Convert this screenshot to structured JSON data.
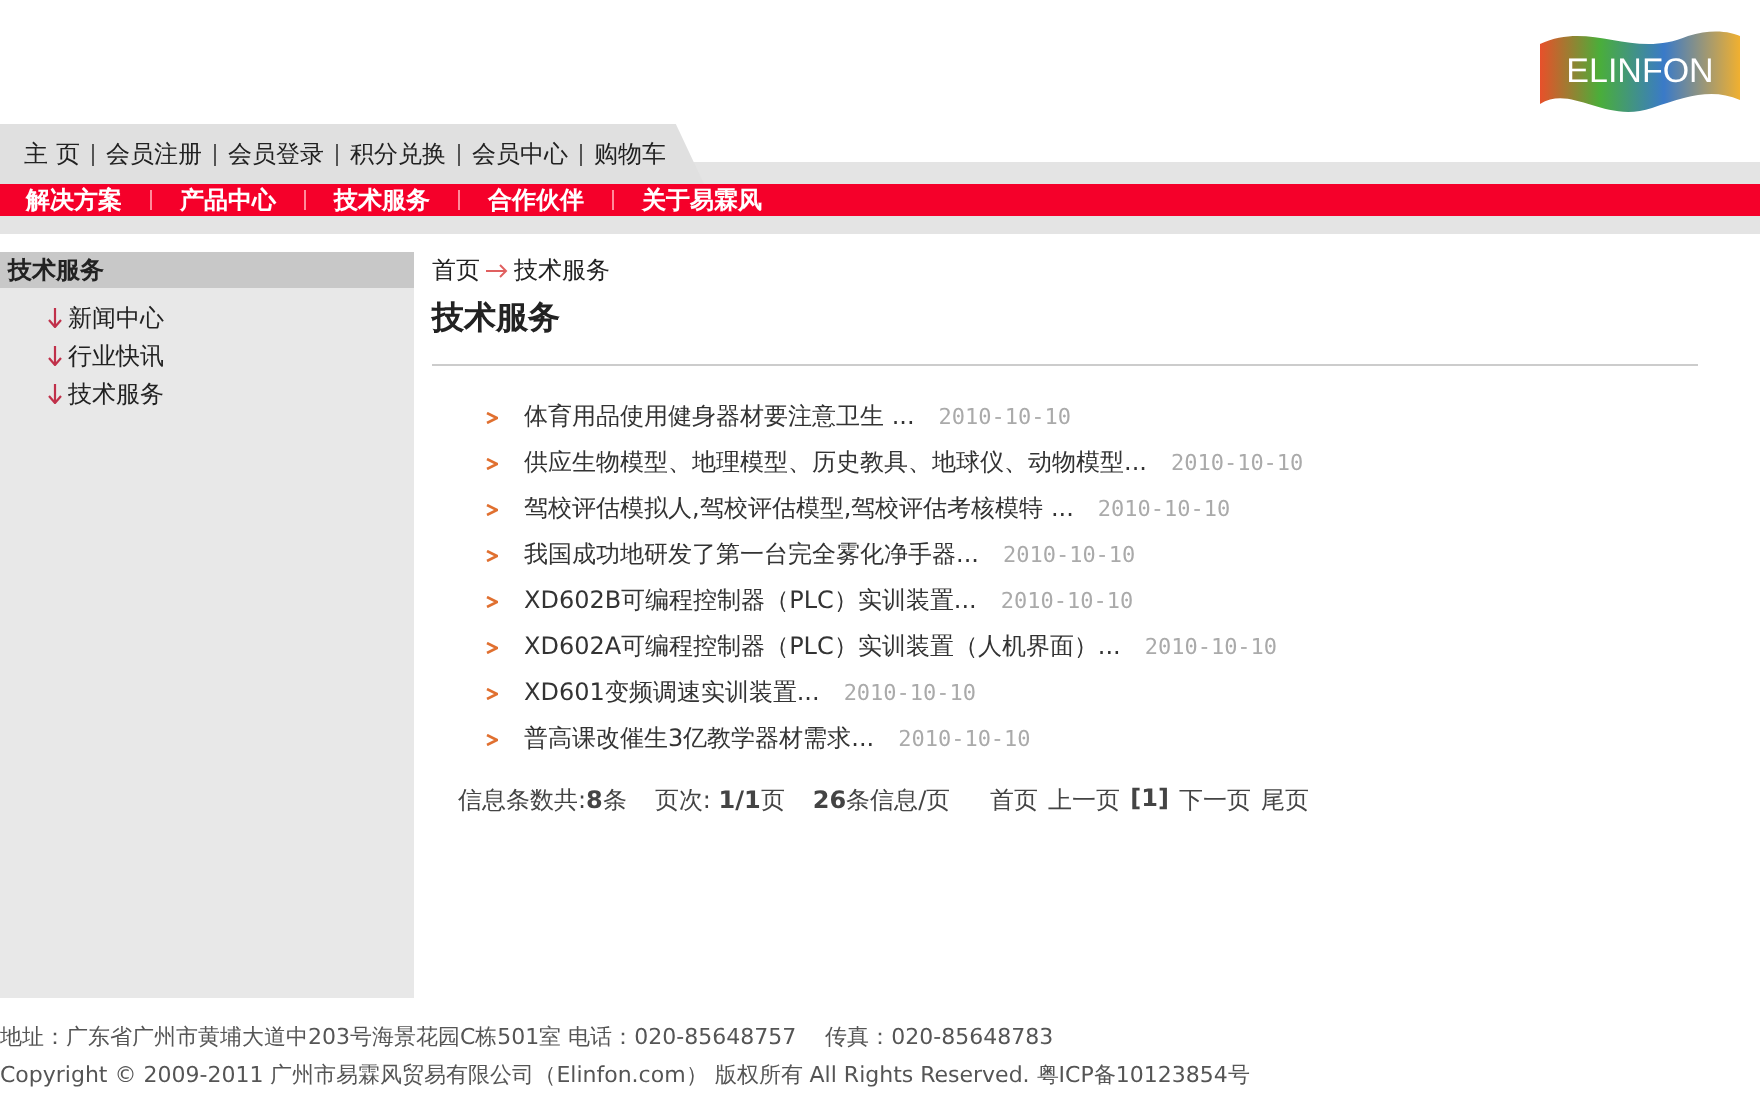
{
  "logo": {
    "text": "ELINFON"
  },
  "top_nav": [
    "主 页",
    "会员注册",
    "会员登录",
    "积分兑换",
    "会员中心",
    "购物车"
  ],
  "main_nav": [
    "解决方案",
    "产品中心",
    "技术服务",
    "合作伙伴",
    "关于易霖风"
  ],
  "sidebar": {
    "title": "技术服务",
    "items": [
      {
        "label": "新闻中心"
      },
      {
        "label": "行业快讯"
      },
      {
        "label": "技术服务"
      }
    ]
  },
  "breadcrumb": [
    "首页",
    "技术服务"
  ],
  "page_title": "技术服务",
  "articles": [
    {
      "title": "体育用品使用健身器材要注意卫生 ...",
      "date": "2010-10-10"
    },
    {
      "title": "供应生物模型、地理模型、历史教具、地球仪、动物模型...",
      "date": "2010-10-10"
    },
    {
      "title": "驾校评估模拟人,驾校评估模型,驾校评估考核模特 ...",
      "date": "2010-10-10"
    },
    {
      "title": "我国成功地研发了第一台完全雾化净手器...",
      "date": "2010-10-10"
    },
    {
      "title": "XD602B可编程控制器（PLC）实训装置...",
      "date": "2010-10-10"
    },
    {
      "title": "XD602A可编程控制器（PLC）实训装置（人机界面）...",
      "date": "2010-10-10"
    },
    {
      "title": "XD601变频调速实训装置...",
      "date": "2010-10-10"
    },
    {
      "title": "普高课改催生3亿教学器材需求...",
      "date": "2010-10-10"
    }
  ],
  "pagination": {
    "info": [
      "信息条数共:**8**条",
      "页次: **1/1**页",
      "**26**条信息/页"
    ],
    "links": [
      {
        "label": "首页"
      },
      {
        "label": "上一页"
      },
      {
        "label": "[1]",
        "kind": "current"
      },
      {
        "label": "下一页"
      },
      {
        "label": "尾页"
      }
    ]
  },
  "footer": [
    "地址：广东省广州市黄埔大道中203号海景花园C栋501室 电话：020-85648757　 传真：020-85648783",
    "Copyright © 2009-2011 广州市易霖风贸易有限公司（Elinfon.com） 版权所有  All Rights Reserved. 粤ICP备10123854号"
  ]
}
